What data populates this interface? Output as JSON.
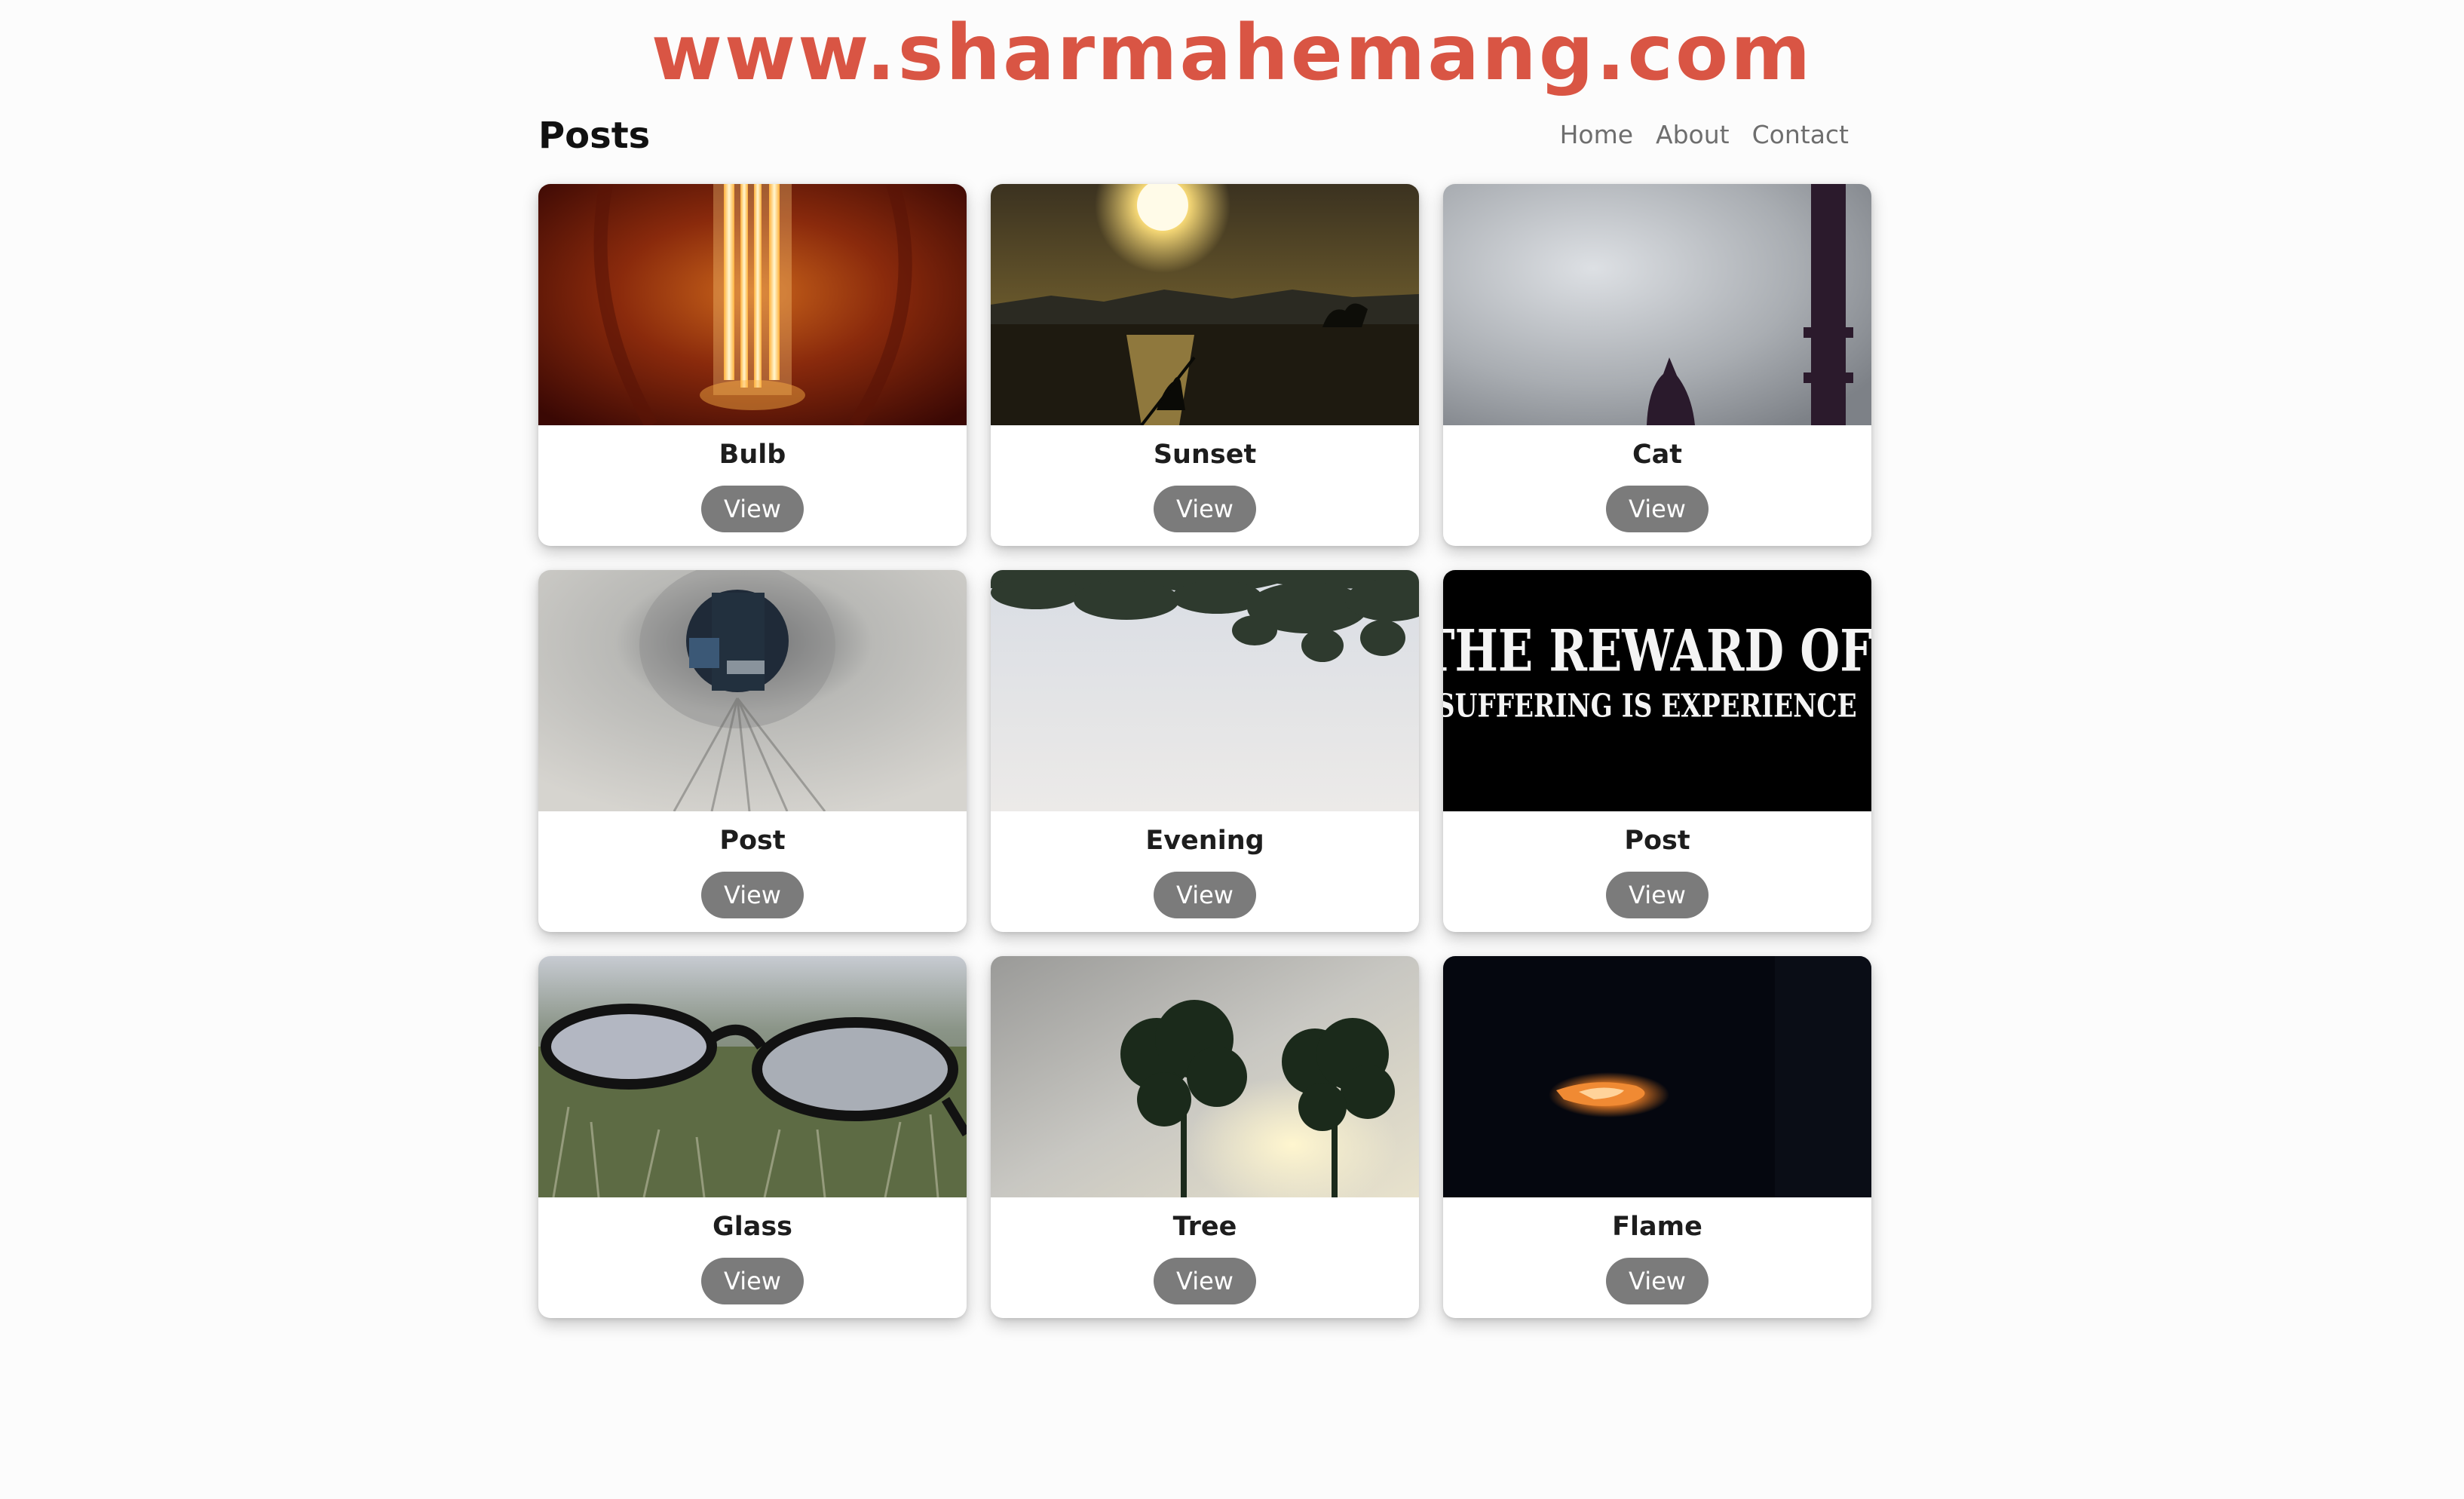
{
  "banner": {
    "text": "www.sharmahemang.com"
  },
  "header": {
    "title": "Posts",
    "nav": [
      {
        "label": "Home"
      },
      {
        "label": "About"
      },
      {
        "label": "Contact"
      }
    ]
  },
  "posts": [
    {
      "title": "Bulb",
      "button": "View",
      "image": "light-bulb-photo"
    },
    {
      "title": "Sunset",
      "button": "View",
      "image": "sunset-lake-photo"
    },
    {
      "title": "Cat",
      "button": "View",
      "image": "cat-silhouette-photo"
    },
    {
      "title": "Post",
      "button": "View",
      "image": "paper-hole-photo"
    },
    {
      "title": "Evening",
      "button": "View",
      "image": "leaves-sky-photo"
    },
    {
      "title": "Post",
      "button": "View",
      "image": "quote-card-image",
      "quote_line_1": "THE REWARD OF",
      "quote_line_2": "SUFFERING IS EXPERIENCE"
    },
    {
      "title": "Glass",
      "button": "View",
      "image": "glasses-grass-photo"
    },
    {
      "title": "Tree",
      "button": "View",
      "image": "trees-sky-photo"
    },
    {
      "title": "Flame",
      "button": "View",
      "image": "flame-dark-photo"
    }
  ],
  "colors": {
    "banner": "#d95544",
    "button": "#7b7b7b",
    "background": "#fcfcfc"
  }
}
